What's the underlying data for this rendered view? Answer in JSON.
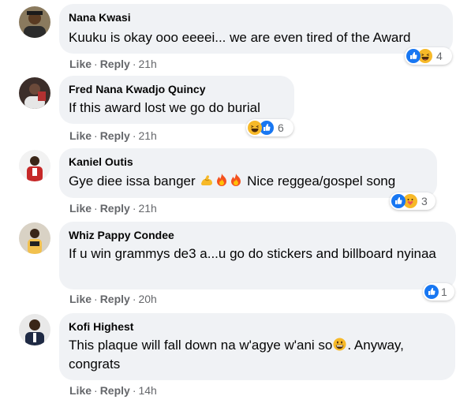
{
  "comments": [
    {
      "author": "Nana Kwasi",
      "text": "Kuuku is okay ooo eeeei... we are even tired of the Award",
      "like": "Like",
      "reply": "Reply",
      "time": "21h",
      "reaction_count": "4",
      "reactions": [
        "like-icon",
        "haha-icon"
      ]
    },
    {
      "author": "Fred Nana Kwadjo Quincy",
      "text": "If this award lost we go do burial",
      "like": "Like",
      "reply": "Reply",
      "time": "21h",
      "reaction_count": "6",
      "reactions": [
        "haha-icon",
        "like-icon"
      ]
    },
    {
      "author": "Kaniel Outis",
      "text_parts": [
        "Gye diee issa banger ",
        " Nice reggea/gospel song"
      ],
      "like": "Like",
      "reply": "Reply",
      "time": "21h",
      "reaction_count": "3",
      "reactions": [
        "like-icon",
        "care-icon"
      ]
    },
    {
      "author": "Whiz Pappy Condee",
      "text": "If u win grammys de3 a...u go do stickers and billboard nyinaa",
      "like": "Like",
      "reply": "Reply",
      "time": "20h",
      "reaction_count": "1",
      "reactions": [
        "like-icon"
      ]
    },
    {
      "author": "Kofi Highest",
      "text_parts": [
        "This plaque will fall down na w'agye w'ani so",
        ". Anyway, congrats"
      ],
      "like": "Like",
      "reply": "Reply",
      "time": "14h",
      "reaction_count": "",
      "reactions": []
    }
  ],
  "colors": {
    "bubble": "#f0f2f5",
    "like_blue": "#1877f2",
    "haha_yellow": "#f7b928",
    "meta_gray": "#65676b"
  }
}
